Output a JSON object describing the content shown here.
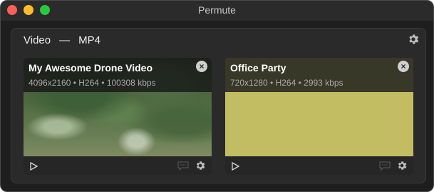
{
  "window": {
    "title": "Permute"
  },
  "group": {
    "format_label": "Video",
    "separator": "—",
    "format_value": "MP4",
    "settings_icon": "gear-icon"
  },
  "items": [
    {
      "title": "My Awesome Drone Video",
      "meta": "4096x2160 • H264 • 100308 kbps",
      "close_icon": "close-icon",
      "play_icon": "play-icon",
      "comment_icon": "comment-icon",
      "settings_icon": "gear-icon"
    },
    {
      "title": "Office Party",
      "meta": "720x1280 • H264 • 2993 kbps",
      "close_icon": "close-icon",
      "play_icon": "play-icon",
      "comment_icon": "comment-icon",
      "settings_icon": "gear-icon"
    }
  ],
  "colors": {
    "window_bg": "#1e1e1e",
    "traffic_close": "#ff5f57",
    "traffic_minimize": "#febc2e",
    "traffic_maximize": "#28c840",
    "office_thumb": "#c2bd62"
  }
}
